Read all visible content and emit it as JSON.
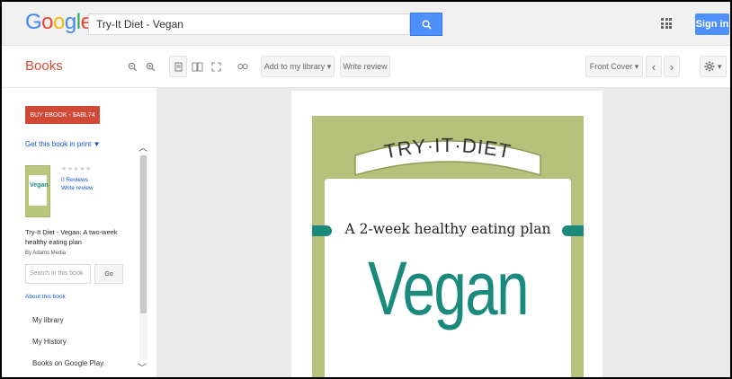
{
  "header": {
    "logo": [
      "G",
      "o",
      "o",
      "g",
      "l",
      "e"
    ],
    "logo_colors": [
      "#4285f4",
      "#ea4335",
      "#fbbc05",
      "#4285f4",
      "#34a853",
      "#ea4335"
    ],
    "search_value": "Try-It Diet - Vegan",
    "signin_label": "Sign in",
    "apps_icon": "apps-grid-icon",
    "search_icon": "search-icon"
  },
  "toolbar": {
    "section_label": "Books",
    "add_library_label": "Add to my library",
    "write_review_label": "Write review",
    "front_cover_label": "Front Cover",
    "chevron": "▾",
    "prev": "‹",
    "next": "›"
  },
  "sidebar": {
    "buy_label": "BUY EBOOK - $ABL74",
    "print_link": "Get this book in print ▼",
    "stars": "★★★★★",
    "reviews": "0 Reviews",
    "write_review": "Write review",
    "thumb_word": "Vegan",
    "book_title": "Try-It Diet - Vegan: A two-week healthy eating plan",
    "author": "By Adams Media",
    "search_placeholder": "Search in this book",
    "go_label": "Go",
    "about_link": "About this book",
    "menu": [
      "My library",
      "My History",
      "Books on Google Play"
    ]
  },
  "cover": {
    "banner": "TRY·IT·DIET",
    "tagline": "A 2-week healthy eating plan",
    "title": "Vegan",
    "accent_color": "#1a8a7d",
    "frame_color": "#b6c17b"
  }
}
